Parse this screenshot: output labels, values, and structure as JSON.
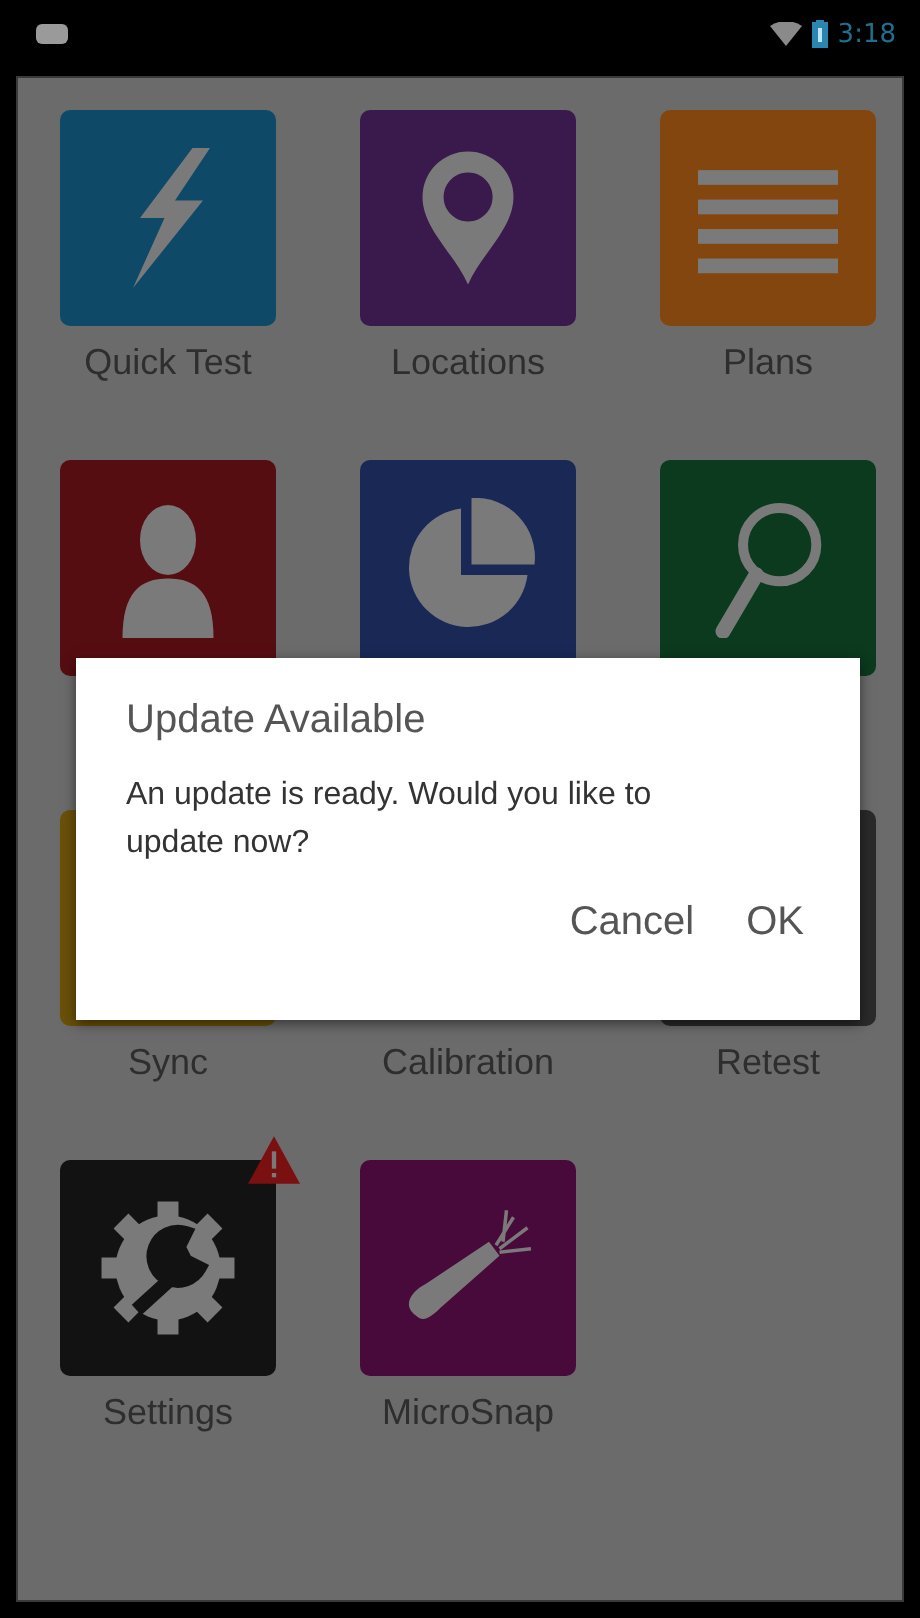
{
  "status_bar": {
    "time": "3:18"
  },
  "tiles": [
    {
      "label": "Quick Test",
      "color": "#0e4a68",
      "kind": "bolt",
      "warning": false
    },
    {
      "label": "Locations",
      "color": "#3a1a4c",
      "kind": "pin",
      "warning": false
    },
    {
      "label": "Plans",
      "color": "#84460f",
      "kind": "lines",
      "warning": false
    },
    {
      "color": "#560d12",
      "kind": "person",
      "warning": false
    },
    {
      "color": "#1a2856",
      "kind": "pie",
      "warning": false
    },
    {
      "color": "#0b3a1e",
      "kind": "magnifier",
      "warning": false
    },
    {
      "label": "Sync",
      "color": "#6a5008",
      "warning": false
    },
    {
      "label": "Calibration",
      "warning": false
    },
    {
      "label": "Retest",
      "color": "#2a2a2a",
      "warning": false
    },
    {
      "label": "Settings",
      "color": "#121212",
      "kind": "gear",
      "warning": true
    },
    {
      "label": "MicroSnap",
      "color": "#480a3a",
      "kind": "swab",
      "warning": false
    }
  ],
  "dialog": {
    "title": "Update Available",
    "message": "An update is ready. Would you like to update now?",
    "buttons": [
      "Cancel",
      "OK"
    ]
  }
}
